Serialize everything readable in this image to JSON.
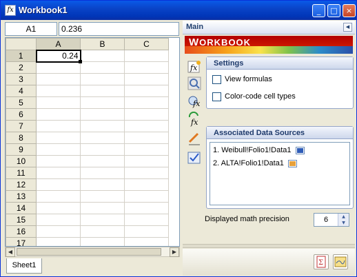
{
  "window": {
    "title": "Workbook1",
    "app_icon": "fx",
    "controls": {
      "minimize": "_",
      "maximize": "□",
      "close": "×"
    }
  },
  "formula_bar": {
    "name_box": "A1",
    "formula": "0.236"
  },
  "grid": {
    "columns": [
      "A",
      "B",
      "C"
    ],
    "rows": [
      "1",
      "2",
      "3",
      "4",
      "5",
      "6",
      "7",
      "8",
      "9",
      "10",
      "11",
      "12",
      "13",
      "14",
      "15",
      "16",
      "17"
    ],
    "active_cell_value": "0.24"
  },
  "sheets": [
    "Sheet1"
  ],
  "panel": {
    "header": "Main",
    "banner": {
      "first": "W",
      "rest": "ORKBOOK"
    },
    "settings": {
      "title": "Settings",
      "view_formulas": "View formulas",
      "color_code": "Color-code cell types"
    },
    "sources": {
      "title": "Associated Data Sources",
      "items": [
        {
          "label": "1. Weibull!Folio1!Data1",
          "icon": "weibull-doc-icon"
        },
        {
          "label": "2. ALTA!Folio1!Data1",
          "icon": "alta-doc-icon"
        }
      ]
    },
    "precision_label": "Displayed math precision",
    "precision_value": "6"
  },
  "toolbar_icons": [
    "insert-function-icon",
    "find-icon",
    "function-analysis-icon",
    "refresh-function-icon",
    "edit-icon",
    "check-icon"
  ],
  "colors": {
    "title_bar": "#0a44c8",
    "banner_red": "#b30000",
    "panel_bg": "#ece9d8"
  }
}
